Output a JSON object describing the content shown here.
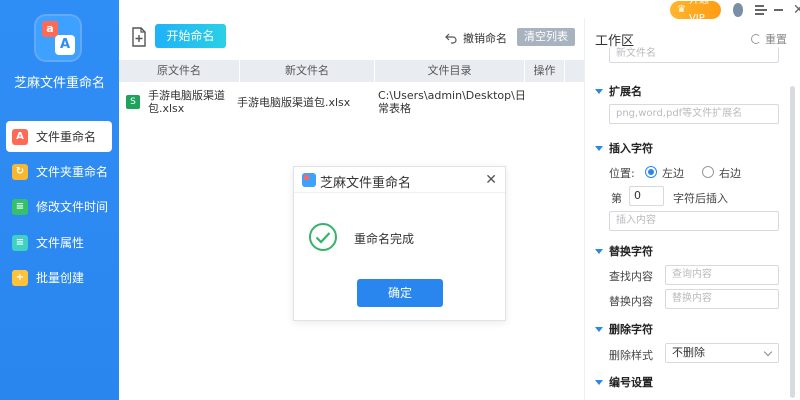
{
  "app": {
    "title": "芝麻文件重命名",
    "logo_letters": [
      "a",
      "A"
    ]
  },
  "sidebar": {
    "items": [
      {
        "label": "文件重命名",
        "active": true,
        "icon": "A"
      },
      {
        "label": "文件夹重命名",
        "active": false,
        "icon": "↻"
      },
      {
        "label": "修改文件时间",
        "active": false,
        "icon": "≡"
      },
      {
        "label": "文件属性",
        "active": false,
        "icon": "≡"
      },
      {
        "label": "批量创建",
        "active": false,
        "icon": "+"
      }
    ]
  },
  "toolbar": {
    "start_label": "开始命名",
    "undo_label": "撤销命名",
    "clear_label": "清空列表"
  },
  "table": {
    "headers": [
      "原文件名",
      "新文件名",
      "文件目录",
      "操作"
    ],
    "rows": [
      {
        "original": "手游电脑版渠道包.xlsx",
        "new_name": "手游电脑版渠道包.xlsx",
        "directory": "C:\\Users\\admin\\Desktop\\日常表格",
        "action": ""
      }
    ]
  },
  "topbar": {
    "vip_label": "开通VIP"
  },
  "panel": {
    "title": "工作区",
    "reset_label": "重置",
    "new_name_placeholder": "新文件名",
    "ext_section": "扩展名",
    "ext_placeholder": "png,word,pdf等文件扩展名",
    "insert_section": "插入字符",
    "position_label": "位置:",
    "left_label": "左边",
    "right_label": "右边",
    "position_selected": "左边",
    "nth_prefix": "第",
    "nth_value": "0",
    "nth_suffix": "字符后插入",
    "insert_placeholder": "插入内容",
    "replace_section": "替换字符",
    "find_label": "查找内容",
    "find_placeholder": "查询内容",
    "replace_label": "替换内容",
    "replace_placeholder": "替换内容",
    "delete_section": "删除字符",
    "delete_style_label": "删除样式",
    "delete_style_value": "不删除",
    "numbering_section": "编号设置"
  },
  "dialog": {
    "title": "芝麻文件重命名",
    "message": "重命名完成",
    "ok_label": "确定"
  },
  "colors": {
    "sidebar": "#2a86ef",
    "accent": "#2a86ef",
    "start_button": "#1fb2f8",
    "vip": "#ff9d14",
    "success": "#35b36a"
  }
}
